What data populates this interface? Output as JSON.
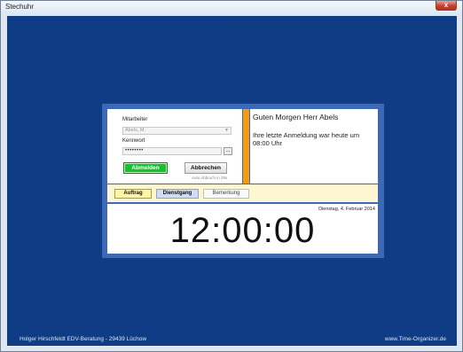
{
  "window": {
    "title": "Stechuhr",
    "close_glyph": "x"
  },
  "login": {
    "mitarbeiter_label": "Mitarbeiter",
    "mitarbeiter_value": "Abels, M.",
    "kennwort_label": "Kennwort",
    "kennwort_value": "••••••••",
    "browse_label": "...",
    "abmelden_label": "Abmelden",
    "abbrechen_label": "Abbrechen",
    "auto_abbruch": "Auto Abbruch in 29s"
  },
  "message": {
    "greeting": "Guten Morgen Herr Abels",
    "last_login": "Ihre letzte Anmeldung war heute um 08:00 Uhr"
  },
  "actions": {
    "auftrag": "Auftrag",
    "dienstgang": "Dienstgang",
    "bemerkung": "Bemerkung"
  },
  "clock": {
    "date": "Dienstag, 4. Februar 2014",
    "time": "12:00:00"
  },
  "footer": {
    "left": "Holger Hirschfeldt EDV-Beratung - 29439 Lüchow",
    "right": "www.Time-Organizer.de"
  },
  "colors": {
    "background": "#0f3c84",
    "dialog_border": "#3d68b5",
    "accent_orange": "#f39c12",
    "abmelden_green": "#15c22a",
    "close_red": "#c7402b"
  }
}
